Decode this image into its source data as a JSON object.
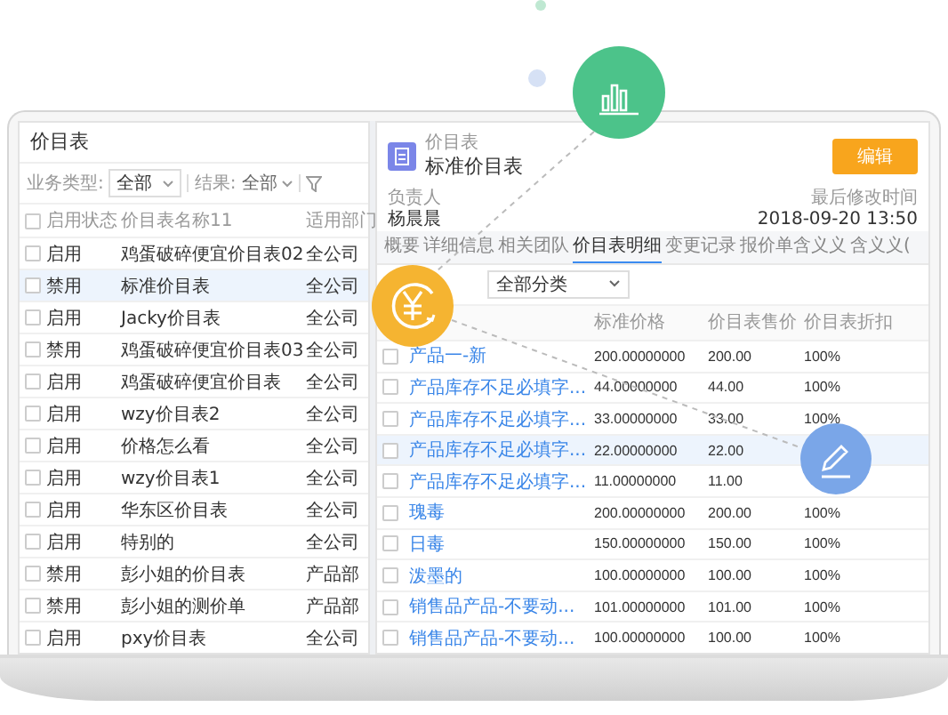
{
  "left_panel": {
    "title": "价目表",
    "filters": [
      {
        "label": "业务类型:",
        "value": "全部",
        "kind": "select"
      },
      {
        "label": "结果:",
        "value": "全部",
        "kind": "inline"
      }
    ],
    "columns": [
      "启用状态",
      "价目表名称11",
      "适用部门"
    ],
    "select_all_checked": false,
    "rows": [
      {
        "status": "启用",
        "name": "鸡蛋破碎便宜价目表02",
        "department": "全公司",
        "selected": false
      },
      {
        "status": "禁用",
        "name": "标准价目表",
        "department": "全公司",
        "selected": true
      },
      {
        "status": "启用",
        "name": "Jacky价目表",
        "department": "全公司",
        "selected": false
      },
      {
        "status": "禁用",
        "name": "鸡蛋破碎便宜价目表03",
        "department": "全公司",
        "selected": false
      },
      {
        "status": "启用",
        "name": "鸡蛋破碎便宜价目表",
        "department": "全公司",
        "selected": false
      },
      {
        "status": "启用",
        "name": "wzy价目表2",
        "department": "全公司",
        "selected": false
      },
      {
        "status": "启用",
        "name": "价格怎么看",
        "department": "全公司",
        "selected": false
      },
      {
        "status": "启用",
        "name": "wzy价目表1",
        "department": "全公司",
        "selected": false
      },
      {
        "status": "启用",
        "name": "华东区价目表",
        "department": "全公司",
        "selected": false
      },
      {
        "status": "启用",
        "name": "特别的",
        "department": "全公司",
        "selected": false
      },
      {
        "status": "禁用",
        "name": "彭小姐的价目表",
        "department": "产品部",
        "selected": false
      },
      {
        "status": "禁用",
        "name": "彭小姐的测价单",
        "department": "产品部",
        "selected": false
      },
      {
        "status": "启用",
        "name": "pxy价目表",
        "department": "全公司",
        "selected": false
      }
    ]
  },
  "record": {
    "type_label": "价目表",
    "title": "标准价目表",
    "edit_button": "编辑",
    "fields": [
      {
        "label": "负责人",
        "value": "杨晨晨"
      },
      {
        "label": "最后修改时间",
        "value": "2018-09-20 13:50"
      }
    ]
  },
  "tabs": [
    {
      "label": "概要",
      "selected": false
    },
    {
      "label": "详细信息",
      "selected": false
    },
    {
      "label": "相关团队",
      "selected": false
    },
    {
      "label": "价目表明细",
      "selected": true
    },
    {
      "label": "变更记录",
      "selected": false
    },
    {
      "label": "报价单含义义",
      "selected": false
    },
    {
      "label": "含义义(",
      "selected": false
    }
  ],
  "detail": {
    "category_select": "全部分类",
    "columns": [
      "标准价格",
      "价目表售价",
      "价目表折扣"
    ],
    "rows": [
      {
        "name": "产品一-新",
        "standard_price": "200.00000000",
        "sale_price": "200.00",
        "discount": "100%",
        "selected": false
      },
      {
        "name": "产品库存不足必填字...",
        "standard_price": "44.00000000",
        "sale_price": "44.00",
        "discount": "100%",
        "selected": false
      },
      {
        "name": "产品库存不足必填字...",
        "standard_price": "33.00000000",
        "sale_price": "33.00",
        "discount": "100%",
        "selected": false
      },
      {
        "name": "产品库存不足必填字...",
        "standard_price": "22.00000000",
        "sale_price": "22.00",
        "selected": true
      },
      {
        "name": "产品库存不足必填字...",
        "standard_price": "11.00000000",
        "sale_price": "11.00",
        "selected": false
      },
      {
        "name": "瑰毒",
        "standard_price": "200.00000000",
        "sale_price": "200.00",
        "discount": "100%",
        "selected": false
      },
      {
        "name": "日毒",
        "standard_price": "150.00000000",
        "sale_price": "150.00",
        "discount": "100%",
        "selected": false
      },
      {
        "name": "泼墨的",
        "standard_price": "100.00000000",
        "sale_price": "100.00",
        "discount": "100%",
        "selected": false
      },
      {
        "name": "销售品产品-不要动...",
        "standard_price": "101.00000000",
        "sale_price": "101.00",
        "discount": "100%",
        "selected": false
      },
      {
        "name": "销售品产品-不要动...",
        "standard_price": "100.00000000",
        "sale_price": "100.00",
        "discount": "100%",
        "selected": false
      }
    ]
  }
}
